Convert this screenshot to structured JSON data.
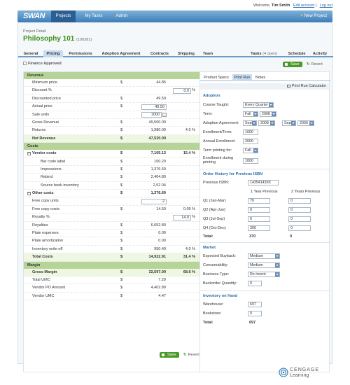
{
  "header": {
    "welcome_prefix": "Welcome,",
    "user": "Tim Smith",
    "edit_account": "Edit account",
    "sep": "|",
    "logout": "Log out",
    "logo": "SWAN",
    "nav": [
      "Projects",
      "My Tasks",
      "Admin"
    ],
    "new_project": "New Project"
  },
  "project": {
    "label": "Project Detail",
    "title": "Philosophy 101",
    "id": "(100281)"
  },
  "subtabs": [
    "General",
    "Pricing",
    "Permissions",
    "Adoption Agreement",
    "Contracts",
    "Shipping",
    "Team",
    "Tasks",
    "(4 open)",
    "Schedule",
    "Activity"
  ],
  "finance_approved": "Finance Approved",
  "actions": {
    "save": "Save",
    "revert": "Revert"
  },
  "revenue": {
    "head": "Revenue",
    "rows": [
      {
        "label": "Minimum price",
        "cur": "$",
        "amt": "44.85",
        "pct": ""
      },
      {
        "label": "Discount %",
        "cur": "",
        "amt": "",
        "pct": "0.0",
        "pct_unit": "%"
      },
      {
        "label": "Discounted price",
        "cur": "$",
        "amt": "49.50",
        "pct": ""
      },
      {
        "label": "Actual price",
        "cur": "$",
        "amt": "49.50",
        "pct": ""
      },
      {
        "label": "Sale units",
        "cur": "",
        "amt": "1000",
        "pct": ""
      },
      {
        "label": "Gross Revenue",
        "cur": "$",
        "amt": "49,500.00",
        "pct": ""
      },
      {
        "label": "Returns",
        "cur": "$",
        "amt": "1,980.00",
        "pct": "4.0 %"
      },
      {
        "label": "Net Revenue",
        "cur": "$",
        "amt": "47,520.00",
        "pct": ""
      }
    ]
  },
  "costs": {
    "head": "Costs",
    "vendor": {
      "label": "Vendor costs",
      "cur": "$",
      "amt": "7,105.13",
      "pct": "15.4 %"
    },
    "vendor_items": [
      {
        "label": "Bar code label",
        "cur": "$",
        "amt": "100.20"
      },
      {
        "label": "Impressions",
        "cur": "$",
        "amt": "1,376.69"
      },
      {
        "label": "Rebind",
        "cur": "$",
        "amt": "2,404.80"
      },
      {
        "label": "Source book inventory",
        "cur": "$",
        "amt": "2,52.04"
      }
    ],
    "other": {
      "label": "Other costs",
      "cur": "$",
      "amt": "1,376.69"
    },
    "other_items": [
      {
        "label": "Free copy units",
        "cur": "",
        "amt": "2",
        "pct": ""
      },
      {
        "label": "Free copy costs",
        "cur": "$",
        "amt": "14.50",
        "pct": "0.05 %"
      },
      {
        "label": "Royalty %",
        "cur": "",
        "amt": "",
        "pct": "14.0",
        "pct_unit": "%"
      },
      {
        "label": "Royalties",
        "cur": "$",
        "amt": "6,652.80",
        "pct": ""
      },
      {
        "label": "Plate expenses",
        "cur": "$",
        "amt": "0.00",
        "pct": ""
      },
      {
        "label": "Plate amortization",
        "cur": "$",
        "amt": "0.00",
        "pct": ""
      },
      {
        "label": "Inventory write off",
        "cur": "$",
        "amt": "950.40",
        "pct": "4.0 %"
      }
    ],
    "total": {
      "label": "Total Costs",
      "cur": "$",
      "amt": "14,922.91",
      "pct": "31.4 %"
    }
  },
  "margin": {
    "head": "Margin",
    "rows": [
      {
        "label": "Gross Margin",
        "cur": "$",
        "amt": "32,597.00",
        "pct": "68.6 %"
      },
      {
        "label": "Total UMC",
        "cur": "$",
        "amt": "7.29",
        "pct": ""
      },
      {
        "label": "Vendor PO Amount",
        "cur": "$",
        "amt": "4,402.89",
        "pct": ""
      },
      {
        "label": "Vendor UMC",
        "cur": "$",
        "amt": "4.47",
        "pct": ""
      }
    ]
  },
  "right": {
    "tabs": [
      "Product Specs",
      "Print Run",
      "Notes"
    ],
    "calc": "Print Run Calculator",
    "adoption": {
      "title": "Adoption",
      "course_taught": "Course Taught:",
      "course_val": "Every Quarter",
      "term": "Term:",
      "term_season": "Fall",
      "term_year": "2008",
      "agreement": "Adoption Agreement:",
      "ag_from_m": "Sept",
      "ag_from_y": "2008",
      "ag_to_m": "Sept",
      "ag_to_y": "2009",
      "enroll_term": "Enrollment/Term:",
      "enroll_term_val": "1000",
      "annual": "Annual Enrollment:",
      "annual_val": "2000",
      "term_print": "Term printing for:",
      "term_print_val": "Fall",
      "during1": "Enrollment during",
      "during2": "printing",
      "during_val": "1000"
    },
    "order": {
      "title": "Order History for Previous ISBN",
      "prev_isbn": "Previous ISBN:",
      "prev_isbn_val": "143541439X",
      "col1": "1 Year Previous",
      "col2": "2 Years Previous",
      "rows": [
        {
          "label": "Q1 (Jan-Mar)",
          "y1": "70",
          "y2": "0"
        },
        {
          "label": "Q2 (Apr-Jun)",
          "y1": "0",
          "y2": "0"
        },
        {
          "label": "Q3 (Jul-Sep)",
          "y1": "0",
          "y2": "0"
        },
        {
          "label": "Q4 (Oct-Dec)",
          "y1": "300",
          "y2": "0"
        }
      ],
      "total": "Total:",
      "total1": "370",
      "total2": "0"
    },
    "market": {
      "title": "Market",
      "buyback": "Expected Buyback:",
      "buyback_val": "Medium",
      "consum": "Consumability:",
      "consum_val": "Medium",
      "btype": "Business Type:",
      "btype_val": "Re-invent",
      "backorder": "Backorder Quantity:",
      "backorder_val": "0"
    },
    "inventory": {
      "title": "Inventory on Hand",
      "warehouse": "Warehouse:",
      "warehouse_val": "697",
      "bookstore": "Bookstore:",
      "bookstore_val": "0",
      "total": "Total:",
      "total_val": "697"
    }
  },
  "brand": {
    "name": "CENGAGE",
    "sub": "Learning"
  }
}
